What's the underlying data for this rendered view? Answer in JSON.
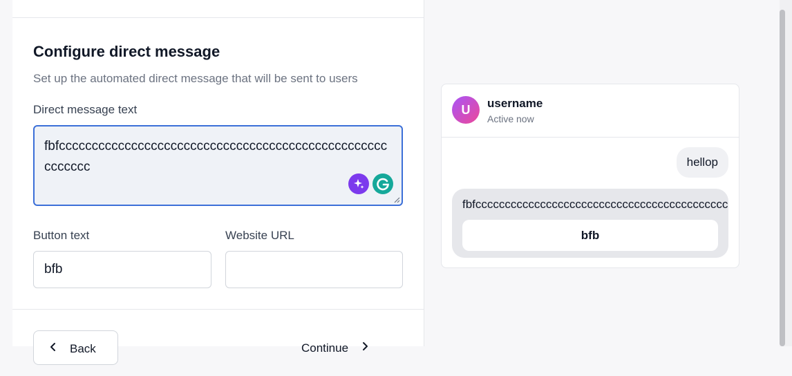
{
  "form": {
    "title": "Configure direct message",
    "subtitle": "Set up the automated direct message that will be sent to users",
    "dm_label": "Direct message text",
    "dm_value": "fbfccccccccccccccccccccccccccccccccccccccccccccccccccccccccc",
    "button_text_label": "Button text",
    "button_text_value": "bfb",
    "website_url_label": "Website URL",
    "website_url_value": "",
    "back_label": "Back",
    "continue_label": "Continue"
  },
  "preview": {
    "avatar_letter": "U",
    "username": "username",
    "status": "Active now",
    "sent_message": "hellop",
    "received_message": "fbfccccccccccccccccccccccccccccccccccccccccccccccccccccccccc",
    "cta_label": "bfb"
  },
  "colors": {
    "accent_border": "#3b6fd8",
    "avatar_gradient_start": "#a855f7",
    "avatar_gradient_end": "#ec4899",
    "sparkle_button": "#7c3aed",
    "grammarly_button": "#15a89a"
  },
  "icons": {
    "sparkle": "sparkle-icon",
    "grammarly": "grammarly-icon",
    "back": "chevron-left-icon",
    "continue": "chevron-right-icon",
    "resize": "resize-handle-icon"
  }
}
